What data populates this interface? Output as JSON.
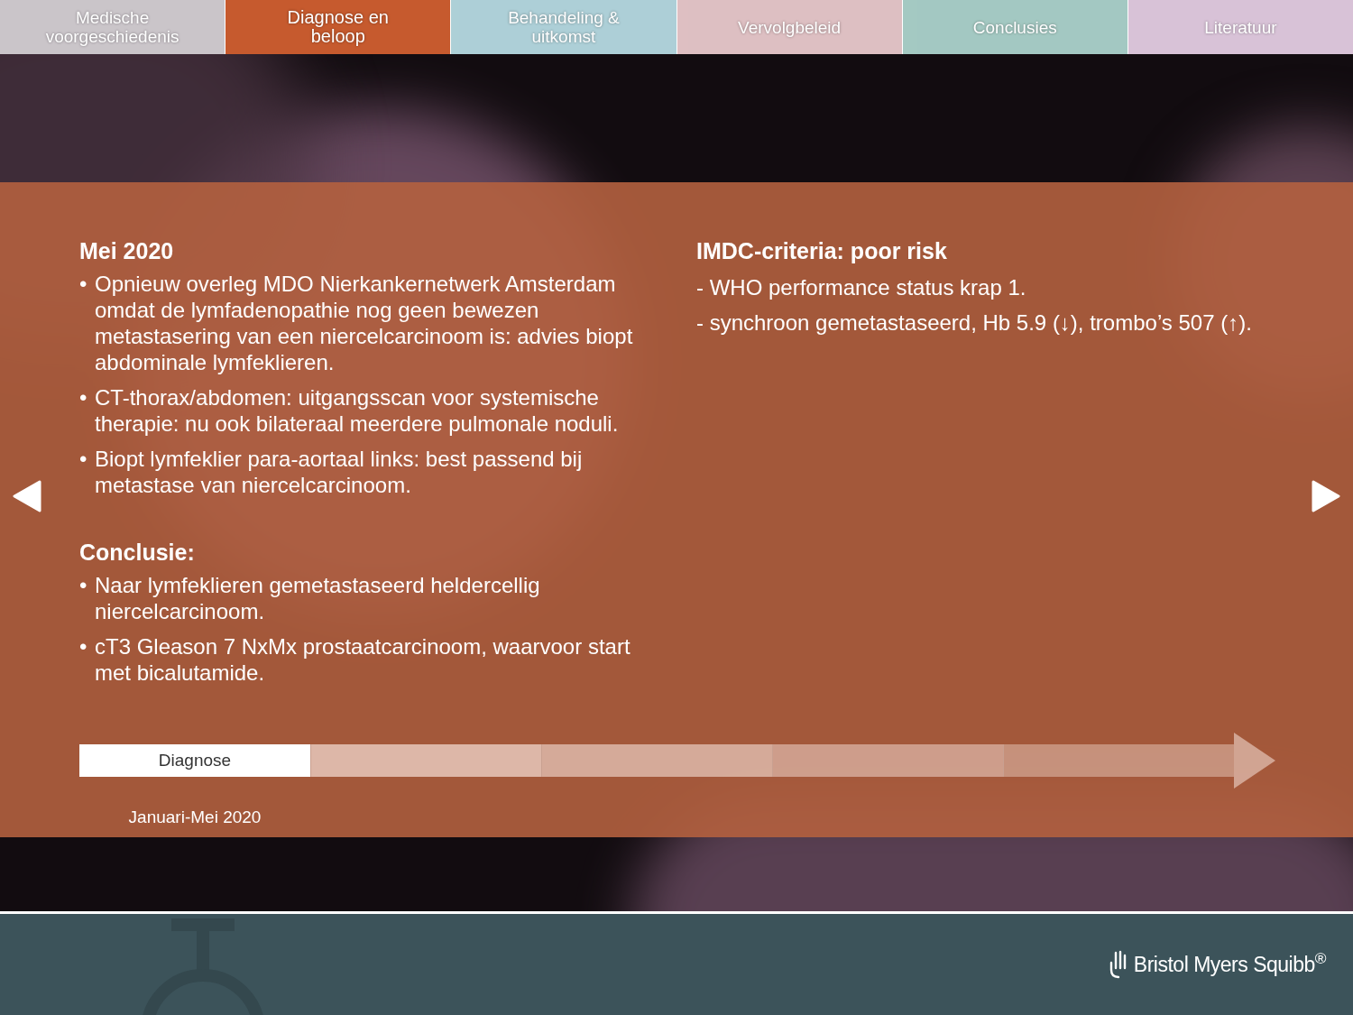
{
  "tabs": [
    {
      "label": "Medische voorgeschiedenis",
      "selected": false,
      "color": "#c8c2c7"
    },
    {
      "label": "Diagnose en beloop",
      "selected": true,
      "color": "#c65a2e"
    },
    {
      "label": "Behandeling & uitkomst",
      "selected": false,
      "color": "#a9cdd5"
    },
    {
      "label": "Vervolgbeleid",
      "selected": false,
      "color": "#dcbcbf"
    },
    {
      "label": "Conclusies",
      "selected": false,
      "color": "#9fc6bf"
    },
    {
      "label": "Literatuur",
      "selected": false,
      "color": "#d6bfd5"
    }
  ],
  "left_sections": [
    {
      "heading": "Mei 2020",
      "bullet": "•",
      "items": [
        "Opnieuw overleg MDO Nierkankernetwerk Amsterdam omdat de lymfadenopathie nog geen bewezen metastasering van een niercelcarcinoom is: advies biopt abdominale lymfeklieren.",
        "CT-thorax/abdomen: uitgangsscan voor systemische therapie: nu ook bilateraal meerdere pulmonale noduli.",
        "Biopt lymfeklier para-aortaal links: best passend bij metastase van niercelcarcinoom."
      ]
    },
    {
      "heading": "Conclusie:",
      "bullet": "•",
      "items": [
        "Naar lymfeklieren gemetastaseerd heldercellig niercelcarcinoom.",
        "cT3 Gleason 7 NxMx prostaatcarcinoom, waarvoor start met bicalutamide."
      ]
    }
  ],
  "right_section": {
    "heading": "IMDC-criteria: poor risk",
    "items": [
      "- WHO performance status krap 1.",
      "- synchroon gemetastaseerd, Hb 5.9 (↓), trombo’s 507 (↑)."
    ]
  },
  "timeline": {
    "segments": [
      {
        "label": "Diagnose",
        "selected": true
      },
      {
        "selected": false
      },
      {
        "selected": false
      },
      {
        "selected": false
      },
      {
        "selected": false
      }
    ],
    "date": "Januari-Mei 2020"
  },
  "footer": {
    "logo": "Bristol Myers Squibb$^{®}$"
  }
}
